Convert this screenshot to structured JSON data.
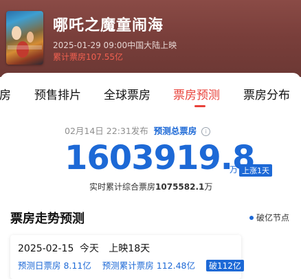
{
  "movie": {
    "title": "哪吒之魔童闹海",
    "release": "2025-01-29 09:00中国大陆上映",
    "cumulative_box": "累计票房107.55亿"
  },
  "tabs": [
    {
      "label": "房",
      "active": false
    },
    {
      "label": "预售排片",
      "active": false
    },
    {
      "label": "全球票房",
      "active": false
    },
    {
      "label": "票房预测",
      "active": true
    },
    {
      "label": "票房分布",
      "active": false
    }
  ],
  "forecast": {
    "update_time": "02月14日 22:31发布",
    "pred_total_label": "预测总票房",
    "info_icon": "ⓘ",
    "big_value": "1603919.8",
    "unit": "万",
    "badge": "上涨1天",
    "realtime_prefix": "实时累计综合票房",
    "realtime_value": "1075582.1",
    "realtime_unit": "万"
  },
  "trend": {
    "title": "票房走势预测",
    "legend_label": "破亿节点",
    "card": {
      "date": "2025-02-15",
      "today": "今天",
      "days": "上映18天",
      "daily_pred": "预测日票房 8.11亿",
      "cum_pred": "预测累计票房 112.48亿",
      "badge": "破112亿"
    }
  },
  "colors": {
    "accent_blue": "#1d69d6",
    "accent_red": "#e8413a",
    "hero_bg": "#7a3f3b"
  }
}
